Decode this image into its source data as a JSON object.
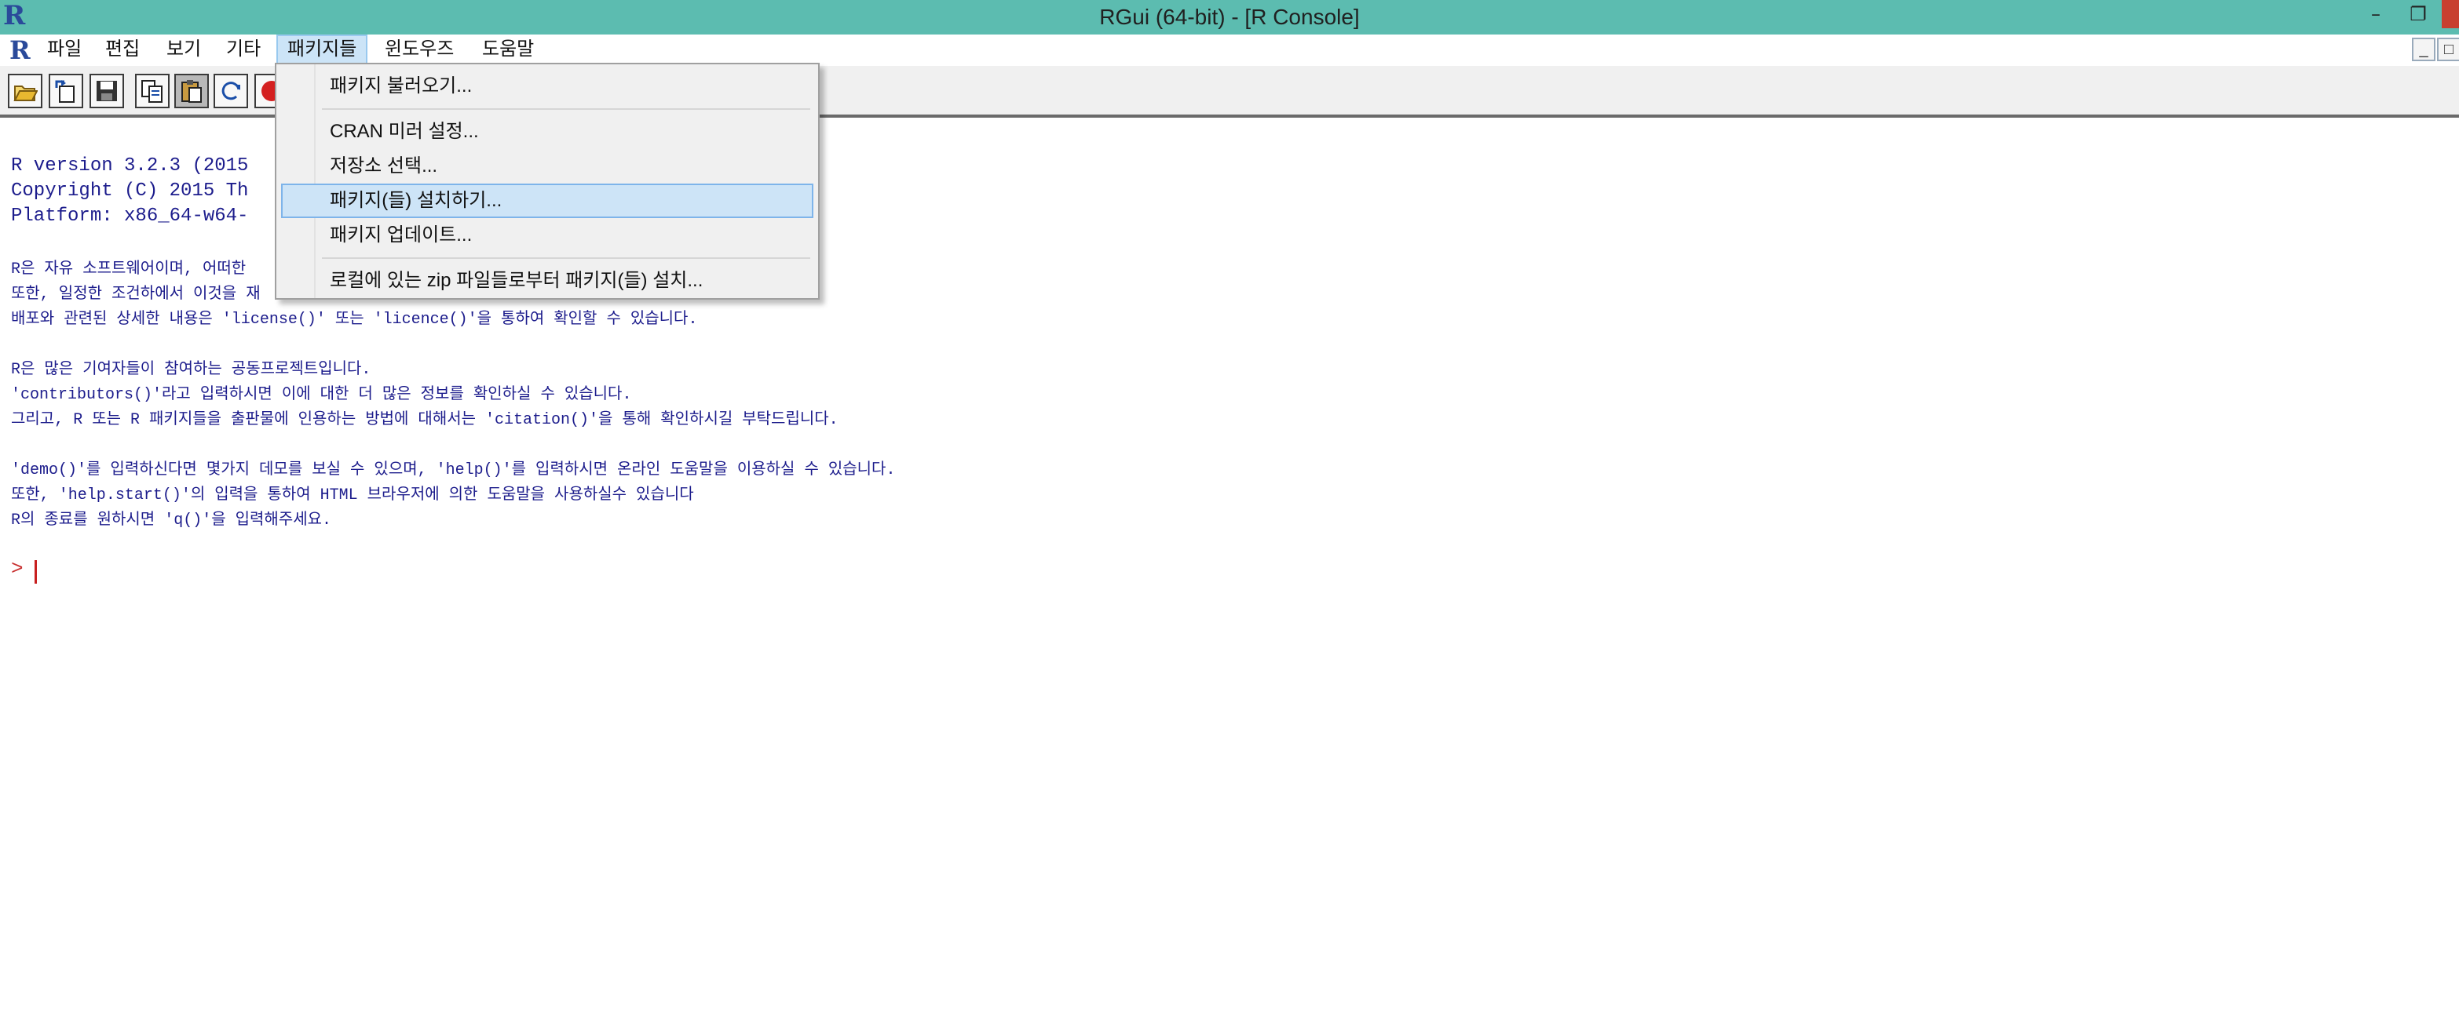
{
  "window": {
    "title": "RGui (64-bit) - [R Console]",
    "app_icon_letter": "R",
    "minimize_glyph": "–",
    "restore_glyph": "❐"
  },
  "menubar": {
    "r_icon_letter": "R",
    "items": [
      "파일",
      "편집",
      "보기",
      "기타",
      "패키지들",
      "윈도우즈",
      "도움말"
    ],
    "active_index": 4,
    "mdi_minimize": "_",
    "mdi_restore": "□"
  },
  "toolbar": {
    "buttons": [
      "open-script-icon",
      "load-workspace-icon",
      "save-icon",
      "copy-icon",
      "paste-icon",
      "refresh-icon",
      "stop-icon"
    ]
  },
  "packages_menu": {
    "items": [
      {
        "label": "패키지 불러오기...",
        "group": 0
      },
      {
        "label": "CRAN 미러 설정...",
        "group": 1
      },
      {
        "label": "저장소 선택...",
        "group": 1
      },
      {
        "label": "패키지(들) 설치하기...",
        "group": 1,
        "highlighted": true
      },
      {
        "label": "패키지 업데이트...",
        "group": 1
      },
      {
        "label": "로컬에 있는 zip 파일들로부터 패키지(들) 설치...",
        "group": 2
      }
    ]
  },
  "console": {
    "lines": [
      "R version 3.2.3 (2015",
      "Copyright (C) 2015 Th",
      "Platform: x86_64-w64-",
      "",
      "R은 자유 소프트웨어이며, 어떠한 ",
      "또한, 일정한 조건하에서 이것을 재",
      "배포와 관련된 상세한 내용은 'license()' 또는 'licence()'을 통하여 확인할 수 있습니다.",
      "",
      "R은 많은 기여자들이 참여하는 공동프로젝트입니다.",
      "'contributors()'라고 입력하시면 이에 대한 더 많은 정보를 확인하실 수 있습니다.",
      "그리고, R 또는 R 패키지들을 출판물에 인용하는 방법에 대해서는 'citation()'을 통해 확인하시길 부탁드립니다.",
      "",
      "'demo()'를 입력하신다면 몇가지 데모를 보실 수 있으며, 'help()'를 입력하시면 온라인 도움말을 이용하실 수 있습니다.",
      "또한, 'help.start()'의 입력을 통하여 HTML 브라우저에 의한 도움말을 사용하실수 있습니다",
      "R의 종료를 원하시면 'q()'을 입력해주세요."
    ],
    "prompt": ">"
  },
  "colors": {
    "titlebar": "#5cbcb0",
    "console_text": "#1c1c8c",
    "prompt": "#c83030",
    "menu_highlight": "#cde4f7"
  }
}
